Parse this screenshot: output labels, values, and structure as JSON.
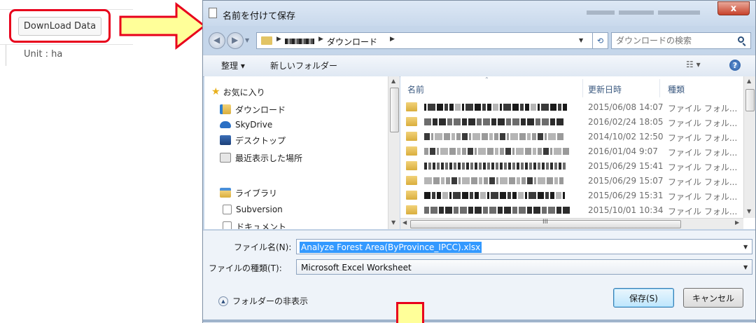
{
  "web": {
    "download_label": "DownLoad Data",
    "unit_label": "Unit : ha"
  },
  "dialog": {
    "title": "名前を付けて保存",
    "close_label": "x",
    "address_crumb": "ダウンロード",
    "search_placeholder": "ダウンロードの検索",
    "toolbar": {
      "organize_label": "整理 ▾",
      "new_folder_label": "新しいフォルダー",
      "view_label": "☷ ▾",
      "help_label": "?"
    },
    "nav": {
      "favorites_label": "お気に入り",
      "downloads_label": "ダウンロード",
      "skydrive_label": "SkyDrive",
      "desktop_label": "デスクトップ",
      "recent_label": "最近表示した場所",
      "libraries_label": "ライブラリ",
      "subversion_label": "Subversion",
      "documents_label": "ドキュメント"
    },
    "columns": {
      "name": "名前",
      "modified": "更新日時",
      "type": "種類"
    },
    "files": [
      {
        "date": "2015/06/08 14:07",
        "type": "ファイル フォル..."
      },
      {
        "date": "2016/02/24 18:05",
        "type": "ファイル フォル..."
      },
      {
        "date": "2014/10/02 12:50",
        "type": "ファイル フォル..."
      },
      {
        "date": "2016/01/04 9:07",
        "type": "ファイル フォル..."
      },
      {
        "date": "2015/06/29 15:41",
        "type": "ファイル フォル..."
      },
      {
        "date": "2015/06/29 15:07",
        "type": "ファイル フォル..."
      },
      {
        "date": "2015/06/29 15:31",
        "type": "ファイル フォル..."
      },
      {
        "date": "2015/10/01 10:34",
        "type": "ファイル フォル..."
      }
    ],
    "filename_label": "ファイル名(N):",
    "filename_value": "Analyze Forest Area(ByProvince_IPCC).xlsx",
    "filetype_label": "ファイルの種類(T):",
    "filetype_value": "Microsoft Excel Worksheet",
    "hide_folders_label": "フォルダーの非表示",
    "save_label": "保存(S)",
    "cancel_label": "キャンセル"
  },
  "colors": {
    "highlight_red": "#e8001c",
    "arrow_yellow": "#ffff99",
    "selection_blue": "#3399ff"
  }
}
